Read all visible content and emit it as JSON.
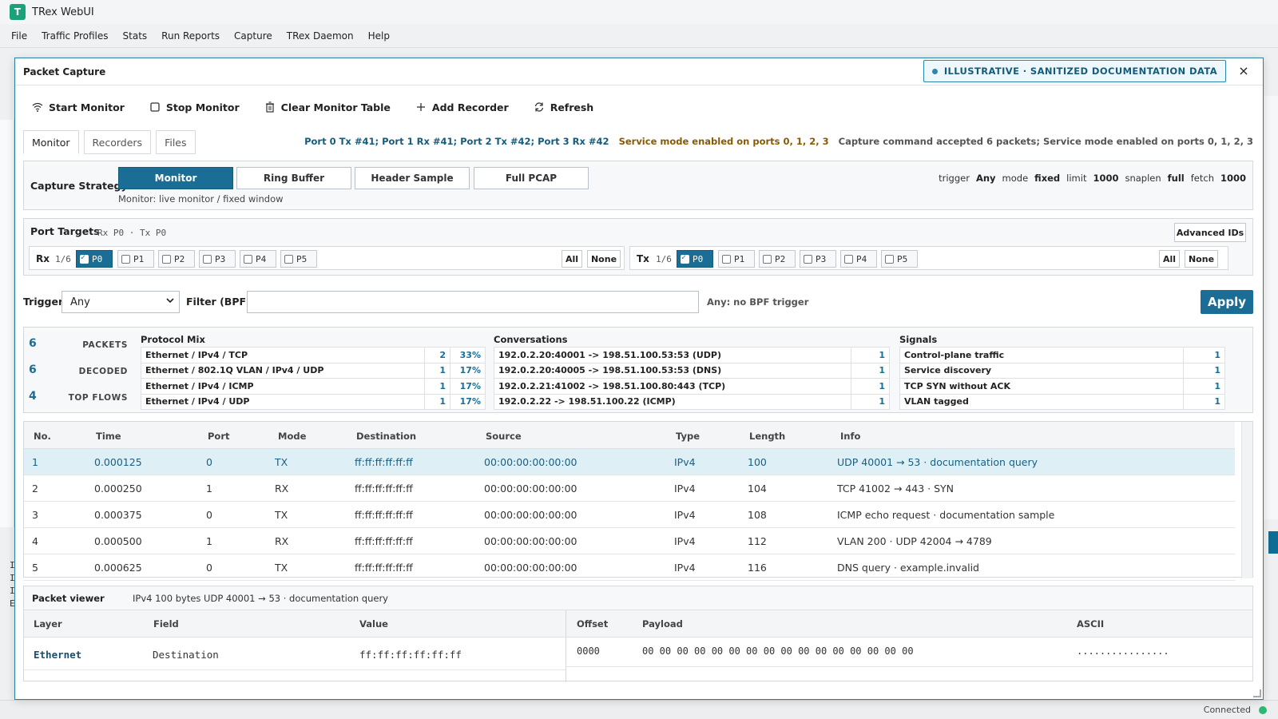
{
  "app": {
    "logo_letter": "T",
    "title": "TRex WebUI",
    "menu": [
      "File",
      "Traffic Profiles",
      "Stats",
      "Run Reports",
      "Capture",
      "TRex Daemon",
      "Help"
    ],
    "status": "Connected",
    "status_color": "#2eb872"
  },
  "dialog": {
    "title": "Packet Capture",
    "badge": "ILLUSTRATIVE · SANITIZED DOCUMENTATION DATA",
    "close_icon": "×",
    "toolbar": {
      "start_monitor": "Start Monitor",
      "stop_monitor": "Stop Monitor",
      "clear_monitor_table": "Clear Monitor Table",
      "add_recorder": "Add Recorder",
      "refresh": "Refresh"
    },
    "tabs": [
      "Monitor",
      "Recorders",
      "Files"
    ],
    "summary": {
      "ports": "Port 0 Tx #41; Port 1 Rx #41; Port 2 Tx #42; Port 3 Rx #42",
      "service_mode": "Service mode enabled on ports 0, 1, 2, 3",
      "capture_result": "Capture command accepted 6 packets; Service mode enabled on ports 0, 1, 2, 3"
    },
    "strategy": {
      "label": "Capture Strategy",
      "options": [
        "Monitor",
        "Ring Buffer",
        "Header Sample",
        "Full PCAP"
      ],
      "selected": "Monitor",
      "description": "Monitor: live monitor / fixed window",
      "params": {
        "trigger_label": "trigger",
        "trigger_value": "Any",
        "mode_label": "mode",
        "mode_value": "fixed",
        "limit_label": "limit",
        "limit_value": "1000",
        "snaplen_label": "snaplen",
        "snaplen_value": "full",
        "fetch_label": "fetch",
        "fetch_value": "1000"
      }
    },
    "port_targets": {
      "label": "Port Targets",
      "sub": "Rx P0 · Tx P0",
      "advanced_button": "Advanced IDs",
      "rx": {
        "label": "Rx",
        "count": "1/6",
        "ports": [
          "P0",
          "P1",
          "P2",
          "P3",
          "P4",
          "P5"
        ],
        "selected": [
          "P0"
        ]
      },
      "tx": {
        "label": "Tx",
        "count": "1/6",
        "ports": [
          "P0",
          "P1",
          "P2",
          "P3",
          "P4",
          "P5"
        ],
        "selected": [
          "P0"
        ]
      },
      "all_label": "All",
      "none_label": "None"
    },
    "trigger": {
      "label": "Trigger",
      "value": "Any",
      "filter_label": "Filter (BPF)",
      "filter_value": "",
      "hint": "Any: no BPF trigger",
      "apply": "Apply"
    },
    "stats": {
      "kpis": [
        {
          "value": "6",
          "label": "PACKETS"
        },
        {
          "value": "6",
          "label": "DECODED"
        },
        {
          "value": "4",
          "label": "TOP FLOWS"
        }
      ],
      "protocol_mix": {
        "title": "Protocol Mix",
        "rows": [
          {
            "name": "Ethernet / IPv4 / TCP",
            "count": "2",
            "pct": "33%"
          },
          {
            "name": "Ethernet / 802.1Q VLAN / IPv4 / UDP",
            "count": "1",
            "pct": "17%"
          },
          {
            "name": "Ethernet / IPv4 / ICMP",
            "count": "1",
            "pct": "17%"
          },
          {
            "name": "Ethernet / IPv4 / UDP",
            "count": "1",
            "pct": "17%"
          }
        ]
      },
      "conversations": {
        "title": "Conversations",
        "rows": [
          {
            "name": "192.0.2.20:40001 -> 198.51.100.53:53 (UDP)",
            "count": "1"
          },
          {
            "name": "192.0.2.20:40005 -> 198.51.100.53:53 (DNS)",
            "count": "1"
          },
          {
            "name": "192.0.2.21:41002 -> 198.51.100.80:443 (TCP)",
            "count": "1"
          },
          {
            "name": "192.0.2.22 -> 198.51.100.22 (ICMP)",
            "count": "1"
          }
        ]
      },
      "signals": {
        "title": "Signals",
        "rows": [
          {
            "name": "Control-plane traffic",
            "count": "1"
          },
          {
            "name": "Service discovery",
            "count": "1"
          },
          {
            "name": "TCP SYN without ACK",
            "count": "1"
          },
          {
            "name": "VLAN tagged",
            "count": "1"
          }
        ]
      }
    },
    "packets": {
      "columns": [
        "No.",
        "Time",
        "Port",
        "Mode",
        "Destination",
        "Source",
        "Type",
        "Length",
        "Info"
      ],
      "rows": [
        {
          "no": "1",
          "time": "0.000125",
          "port": "0",
          "mode": "TX",
          "dst": "ff:ff:ff:ff:ff:ff",
          "src": "00:00:00:00:00:00",
          "type": "IPv4",
          "len": "100",
          "info": "UDP 40001 → 53 · documentation query"
        },
        {
          "no": "2",
          "time": "0.000250",
          "port": "1",
          "mode": "RX",
          "dst": "ff:ff:ff:ff:ff:ff",
          "src": "00:00:00:00:00:00",
          "type": "IPv4",
          "len": "104",
          "info": "TCP 41002 → 443 · SYN"
        },
        {
          "no": "3",
          "time": "0.000375",
          "port": "0",
          "mode": "TX",
          "dst": "ff:ff:ff:ff:ff:ff",
          "src": "00:00:00:00:00:00",
          "type": "IPv4",
          "len": "108",
          "info": "ICMP echo request · documentation sample"
        },
        {
          "no": "4",
          "time": "0.000500",
          "port": "1",
          "mode": "RX",
          "dst": "ff:ff:ff:ff:ff:ff",
          "src": "00:00:00:00:00:00",
          "type": "IPv4",
          "len": "112",
          "info": "VLAN 200 · UDP 42004 → 4789"
        },
        {
          "no": "5",
          "time": "0.000625",
          "port": "0",
          "mode": "TX",
          "dst": "ff:ff:ff:ff:ff:ff",
          "src": "00:00:00:00:00:00",
          "type": "IPv4",
          "len": "116",
          "info": "DNS query · example.invalid"
        }
      ]
    },
    "viewer": {
      "title": "Packet viewer",
      "summary": "IPv4 100 bytes UDP 40001 → 53 · documentation query",
      "columns": {
        "layer": "Layer",
        "field": "Field",
        "value": "Value",
        "offset": "Offset",
        "payload": "Payload",
        "ascii": "ASCII"
      },
      "row": {
        "layer": "Ethernet",
        "field": "Destination",
        "value": "ff:ff:ff:ff:ff:ff",
        "offset": "0000",
        "payload": "00 00 00 00 00 00 00 00 00 00 00 00 00 00 00 00",
        "ascii": "................"
      }
    }
  }
}
